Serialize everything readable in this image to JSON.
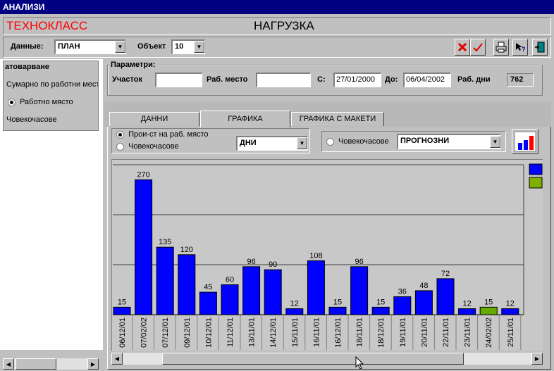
{
  "window": {
    "title": "АНАЛИЗИ"
  },
  "header": {
    "brand": "ТЕХНОКЛАСС",
    "title": "НАГРУЗКА",
    "brand_color": "#ff0000"
  },
  "toolbar": {
    "data_label": "Данные:",
    "data_value": "ПЛАН",
    "object_label": "Объект",
    "object_value": "10"
  },
  "left_panel": {
    "group_title": "атоварване",
    "opt1": "Сумарно по работни мест",
    "opt2": "Работно място",
    "opt3": "Човекочасове"
  },
  "params": {
    "title": "Параметри:",
    "section_label": "Участок",
    "workplace_label": "Раб. место",
    "from_label": "С:",
    "from_value": "27/01/2000",
    "to_label": "До:",
    "to_value": "06/04/2002",
    "workdays_label": "Раб. дни",
    "workdays_value": "762"
  },
  "tabs": [
    "ДАННИ",
    "ГРАФИКА",
    "ГРАФИКА С МАКЕТИ"
  ],
  "chart_controls": {
    "radio1": "Прои-ст на раб. място",
    "radio2": "Човекочасове",
    "period_value": "ДНИ",
    "radio3": "Човекочасове",
    "forecast_value": "ПРОГНОЗНИ"
  },
  "chart_data": {
    "type": "bar",
    "categories": [
      "06/12/01",
      "07/02/02",
      "07/12/01",
      "09/12/01",
      "10/12/01",
      "11/12/01",
      "13/11/01",
      "14/12/01",
      "15/11/01",
      "16/11/01",
      "16/12/01",
      "18/11/01",
      "18/12/01",
      "19/11/01",
      "20/11/01",
      "22/11/01",
      "23/11/01",
      "24/02/02",
      "25/11/01"
    ],
    "values": [
      15,
      270,
      135,
      120,
      45,
      60,
      96,
      90,
      12,
      108,
      15,
      96,
      15,
      36,
      48,
      72,
      12,
      15,
      12
    ],
    "colors": [
      "#0000ff",
      "#0000ff",
      "#0000ff",
      "#0000ff",
      "#0000ff",
      "#0000ff",
      "#0000ff",
      "#0000ff",
      "#0000ff",
      "#0000ff",
      "#0000ff",
      "#0000ff",
      "#0000ff",
      "#0000ff",
      "#0000ff",
      "#0000ff",
      "#0000ff",
      "#66aa00",
      "#0000ff"
    ],
    "ylim": [
      0,
      300
    ],
    "gridlines": [
      100,
      200,
      300
    ],
    "legend_colors": [
      "#0000ff",
      "#7fb000"
    ],
    "legend_placement": "top-right"
  }
}
